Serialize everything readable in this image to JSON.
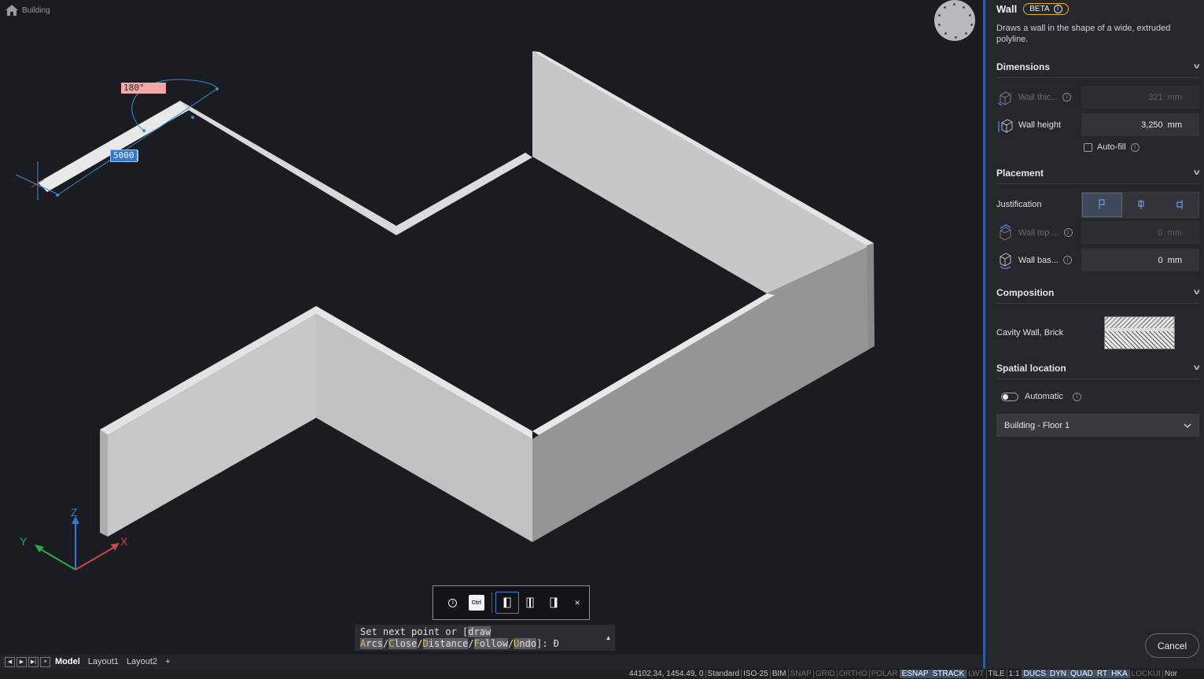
{
  "breadcrumb": {
    "label": "Building"
  },
  "viewport": {
    "dim_angle": "180°",
    "dim_length": "5000",
    "axes": {
      "x": "X",
      "y": "Y",
      "z": "Z"
    }
  },
  "snap_toolbar": {
    "ctrl_label": "Ctrl",
    "close_label": "×"
  },
  "command_line": {
    "prefix": "Set next point or [",
    "opt_draw": "draw",
    "opt_arcs_key": "A",
    "opt_arcs_rest": "rcs",
    "opt_close_key": "C",
    "opt_close_rest": "lose",
    "opt_distance_key": "D",
    "opt_distance_rest": "istance",
    "opt_follow_key": "F",
    "opt_follow_rest": "ollow",
    "opt_undo_key": "U",
    "opt_undo_rest": "ndo",
    "suffix": "]: Đ",
    "sep": "/"
  },
  "tabs": {
    "items": [
      "Model",
      "Layout1",
      "Layout2"
    ],
    "add": "+"
  },
  "status_bar": {
    "coords": "44102.34, 1454.49, 0",
    "items": [
      "Standard",
      "ISO-25",
      "BIM",
      "SNAP",
      "GRID",
      "ORTHO",
      "POLAR",
      "ESNAP",
      "STRACK",
      "LWT",
      "TILE",
      "1:1",
      "DUCS",
      "DYN",
      "QUAD",
      "RT",
      "HKA",
      "LOCKUI",
      "Nor"
    ],
    "dim_items": [
      "SNAP",
      "GRID",
      "ORTHO",
      "POLAR",
      "LWT",
      "LOCKUI"
    ],
    "on_items": [
      "ESNAP",
      "STRACK",
      "DUCS",
      "DYN",
      "QUAD",
      "RT",
      "HKA"
    ]
  },
  "panel": {
    "title": "Wall",
    "badge": "BETA",
    "description": "Draws a wall in the shape of a wide, extruded polyline.",
    "dimensions": {
      "header": "Dimensions",
      "wall_thickness_label": "Wall thic...",
      "wall_thickness_value": "321",
      "wall_thickness_unit": "mm",
      "wall_height_label": "Wall height",
      "wall_height_value": "3,250",
      "wall_height_unit": "mm",
      "autofill_label": "Auto-fill"
    },
    "placement": {
      "header": "Placement",
      "justification_label": "Justification",
      "wall_top_label": "Wall top ...",
      "wall_top_value": "0",
      "wall_top_unit": "mm",
      "wall_base_label": "Wall bas...",
      "wall_base_value": "0",
      "wall_base_unit": "mm"
    },
    "composition": {
      "header": "Composition",
      "material_label": "Cavity Wall, Brick"
    },
    "spatial": {
      "header": "Spatial location",
      "automatic_label": "Automatic",
      "floor_value": "Building - Floor 1"
    },
    "cancel_label": "Cancel"
  },
  "colors": {
    "background": "#1b1c21",
    "panel": "#26272c",
    "accent": "#2f5ea8",
    "beta_border": "#e6b325",
    "wall_face_light": "#c8c8c8",
    "wall_face_dark": "#8f8f8f"
  }
}
